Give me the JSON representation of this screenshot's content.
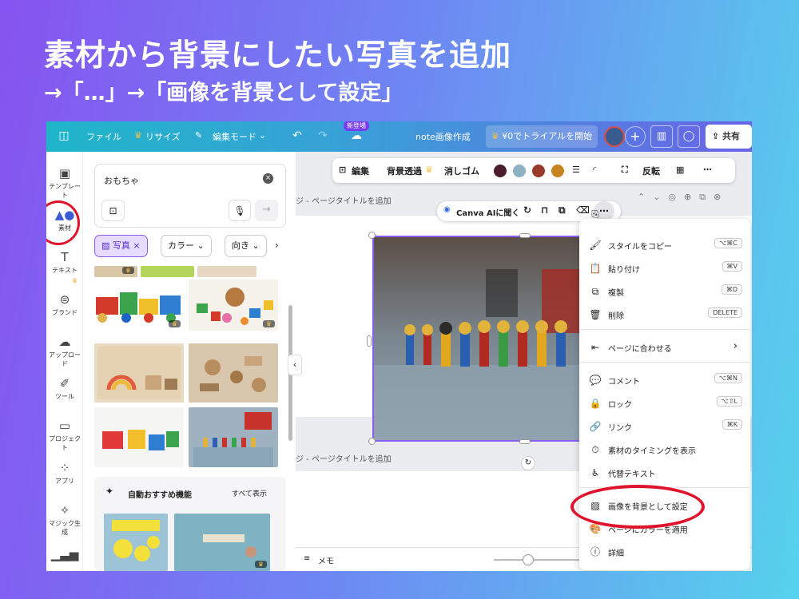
{
  "slide": {
    "heading": "素材から背景にしたい写真を追加",
    "subheading": "→「…」→「画像を背景として設定」"
  },
  "topbar": {
    "file": "ファイル",
    "resize": "リサイズ",
    "edit_mode": "編集モード",
    "new_badge": "新登場",
    "doc_title": "note画像作成",
    "trial": "¥0でトライアルを開始",
    "share": "共有"
  },
  "rail": {
    "items": [
      {
        "label": "テンプレート",
        "icon": "template-icon"
      },
      {
        "label": "素材",
        "icon": "elements-icon"
      },
      {
        "label": "テキスト",
        "icon": "text-icon"
      },
      {
        "label": "ブランド",
        "icon": "brand-icon"
      },
      {
        "label": "アップロード",
        "icon": "upload-icon"
      },
      {
        "label": "ツール",
        "icon": "tools-icon"
      },
      {
        "label": "プロジェクト",
        "icon": "folder-icon"
      },
      {
        "label": "アプリ",
        "icon": "apps-icon"
      },
      {
        "label": "マジック生成",
        "icon": "magic-icon"
      }
    ]
  },
  "panel": {
    "search_value": "おもちゃ",
    "chips": {
      "photo": "写真",
      "color": "カラー",
      "orientation": "向き"
    },
    "ai_section": {
      "title": "自動おすすめ機能",
      "see_all": "すべて表示"
    }
  },
  "toolbar": {
    "edit": "編集",
    "bg_remove": "背景透過",
    "eraser": "消しゴム",
    "flip": "反転",
    "colors": [
      "#4a1e2c",
      "#8fb1c4",
      "#9a3a29",
      "#c8851f"
    ]
  },
  "canvas": {
    "page_label": "ジ - ページタイトルを追加",
    "page2_label": "ジ - ページタイトルを追加",
    "ask_ai": "Canva AIに聞く",
    "memo": "メモ"
  },
  "context_menu": {
    "items": [
      {
        "label": "スタイルをコピー",
        "shortcut": "⌥⌘C",
        "icon": "paint-roller-icon"
      },
      {
        "label": "貼り付け",
        "shortcut": "⌘V",
        "icon": "clipboard-icon"
      },
      {
        "label": "複製",
        "shortcut": "⌘D",
        "icon": "duplicate-icon"
      },
      {
        "label": "削除",
        "shortcut": "DELETE",
        "icon": "trash-icon"
      },
      {
        "label": "ページに合わせる",
        "shortcut": "",
        "icon": "fit-page-icon"
      },
      {
        "label": "コメント",
        "shortcut": "⌥⌘N",
        "icon": "comment-icon"
      },
      {
        "label": "ロック",
        "shortcut": "⌥⇧L",
        "icon": "lock-icon"
      },
      {
        "label": "リンク",
        "shortcut": "⌘K",
        "icon": "link-icon"
      },
      {
        "label": "素材のタイミングを表示",
        "shortcut": "",
        "icon": "timer-icon"
      },
      {
        "label": "代替テキスト",
        "shortcut": "",
        "icon": "accessibility-icon"
      },
      {
        "label": "画像を背景として設定",
        "shortcut": "",
        "icon": "background-icon"
      },
      {
        "label": "ページにカラーを適用",
        "shortcut": "",
        "icon": "palette-icon"
      },
      {
        "label": "詳細",
        "shortcut": "",
        "icon": "info-icon"
      }
    ]
  }
}
